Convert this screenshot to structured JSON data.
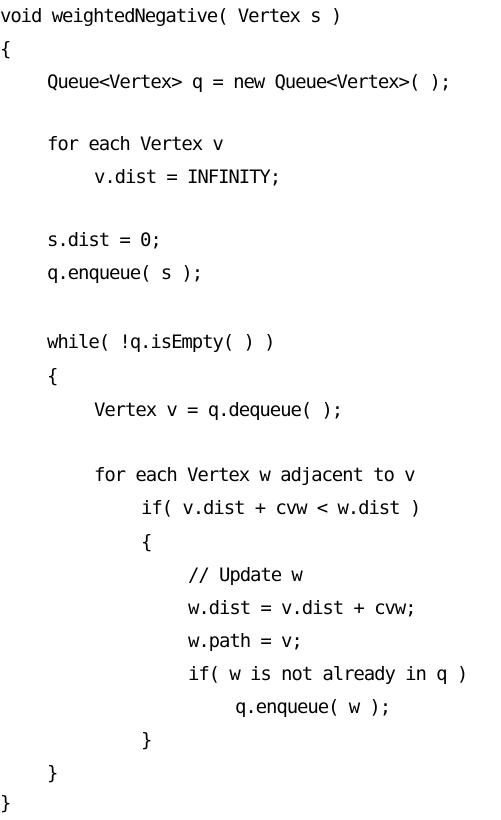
{
  "code": {
    "lines": [
      "void weightedNegative( Vertex s )",
      "{",
      "Queue<Vertex> q = new Queue<Vertex>( );",
      "for each Vertex v",
      "v.dist = INFINITY;",
      "s.dist = 0;",
      "q.enqueue( s );",
      "while( !q.isEmpty( ) )",
      "{",
      "Vertex v = q.dequeue( );",
      "for each Vertex w adjacent to v",
      "if( v.dist + cvw < w.dist )",
      "{",
      "// Update w",
      "w.dist = v.dist + cvw;",
      "w.path = v;",
      "if( w is not already in q )",
      "q.enqueue( w );",
      "}",
      "}",
      "}"
    ]
  }
}
